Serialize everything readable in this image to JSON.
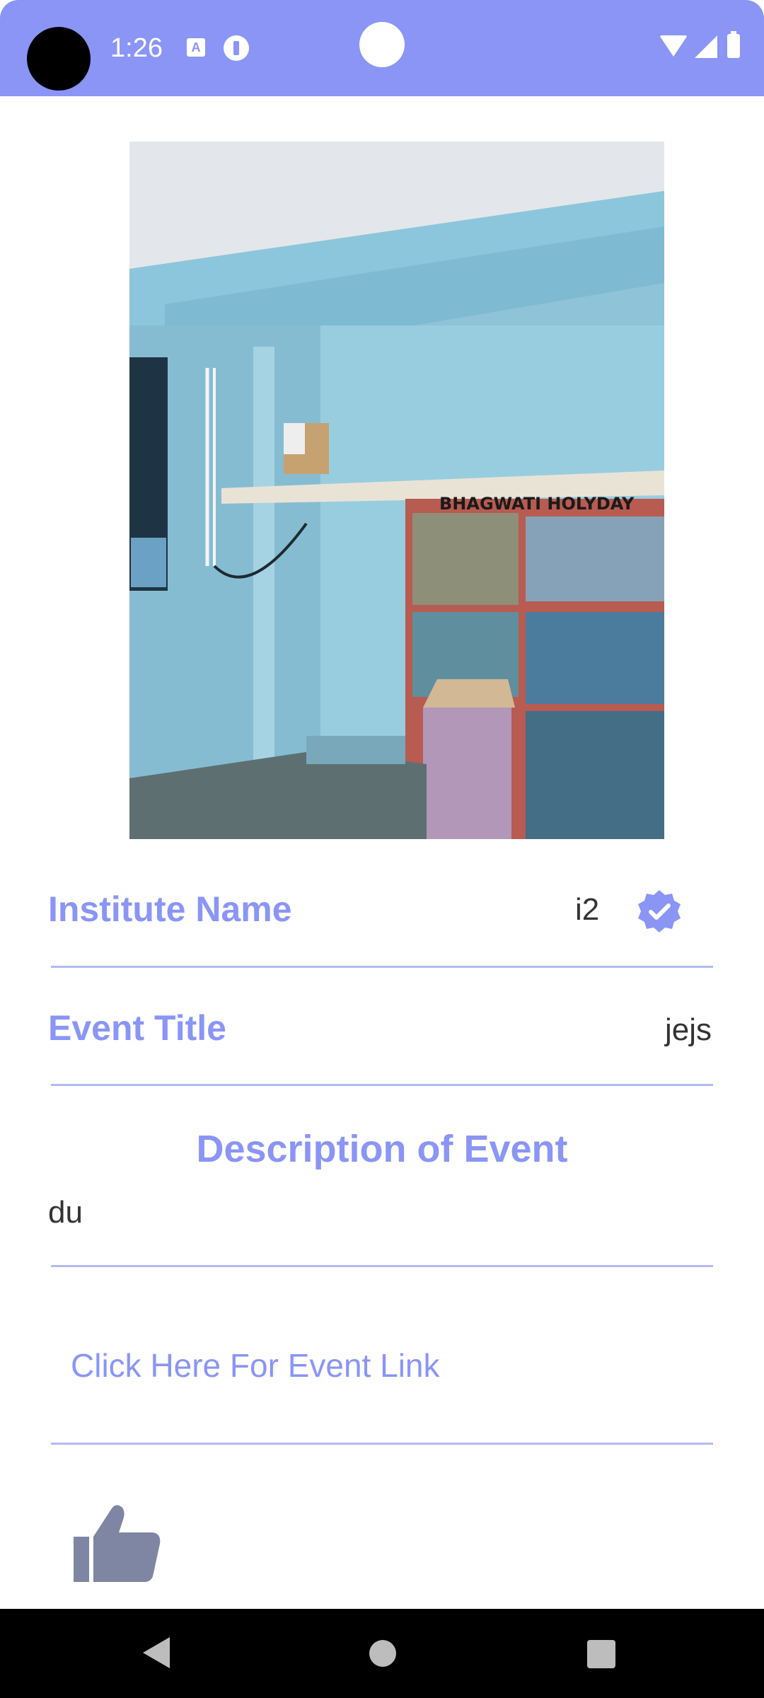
{
  "status_bar": {
    "time": "1:26",
    "icons": [
      "camera-hole",
      "text-recognition-icon",
      "notification-icon",
      "wifi-icon",
      "signal-icon",
      "battery-icon"
    ],
    "color": "#8a95f6"
  },
  "event": {
    "image": {
      "description_icon": "event-photo",
      "poster_text": "BHAGWATI HOLYDAY"
    },
    "institute_name_label": "Institute Name",
    "institute_name_value": "i2",
    "verified_icon": "verified-badge-icon",
    "event_title_label": "Event Title",
    "event_title_value": "jejs",
    "description_heading": "Description of Event",
    "description_value": "du",
    "link_text": "Click Here For Event Link",
    "like_icon": "thumbs-up-icon"
  },
  "colors": {
    "accent": "#8a95f6",
    "divider": "#b3b9f5",
    "text": "#333333",
    "like_icon": "#7f86a3"
  },
  "nav_bar": {
    "icons": [
      "back-icon",
      "home-icon",
      "recents-icon"
    ]
  }
}
